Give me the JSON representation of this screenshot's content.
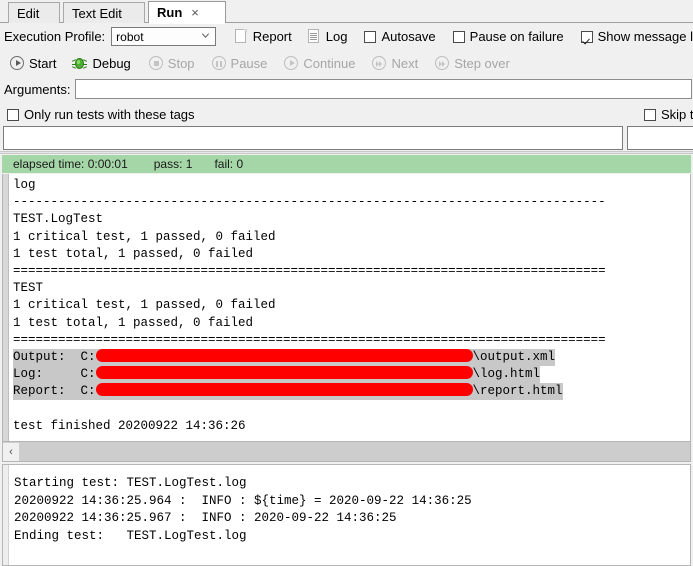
{
  "tabs": [
    {
      "label": "Edit",
      "active": false,
      "closable": false
    },
    {
      "label": "Text Edit",
      "active": false,
      "closable": false
    },
    {
      "label": "Run",
      "active": true,
      "closable": true,
      "close_glyph": "×"
    }
  ],
  "toolbar": {
    "execution_profile_label": "Execution Profile:",
    "execution_profile_value": "robot",
    "execution_profile_options": [
      "robot"
    ],
    "report_label": "Report",
    "log_label": "Log",
    "autosave_label": "Autosave",
    "autosave_checked": false,
    "pause_on_failure_label": "Pause on failure",
    "pause_on_failure_checked": false,
    "show_message_label": "Show message l",
    "show_message_checked": true,
    "start_label": "Start",
    "debug_label": "Debug",
    "stop_label": "Stop",
    "pause_label": "Pause",
    "continue_label": "Continue",
    "next_label": "Next",
    "step_over_label": "Step over",
    "arguments_label": "Arguments:",
    "arguments_value": "",
    "only_run_tags_label": "Only run tests with these tags",
    "only_run_tags_checked": false,
    "only_run_tags_value": "",
    "skip_tests_label": "Skip test",
    "skip_tests_checked": false,
    "skip_tests_value": ""
  },
  "status": {
    "elapsed_label": "elapsed time: 0:00:01",
    "pass_label": "pass: 1",
    "fail_label": "fail: 0",
    "color": "#a5d6a7"
  },
  "log": {
    "lines": [
      "log",
      "-------------------------------------------------------------------------------",
      "TEST.LogTest",
      "1 critical test, 1 passed, 0 failed",
      "1 test total, 1 passed, 0 failed",
      "===============================================================================",
      "TEST",
      "1 critical test, 1 passed, 0 failed",
      "1 test total, 1 passed, 0 failed",
      "==============================================================================="
    ],
    "paths": [
      {
        "label": "Output:  ",
        "prefix": "C:",
        "redacted_width": 377,
        "suffix": "\\output.xml"
      },
      {
        "label": "Log:     ",
        "prefix": "C:",
        "redacted_width": 377,
        "suffix": "\\log.html"
      },
      {
        "label": "Report:  ",
        "prefix": "C:",
        "redacted_width": 377,
        "suffix": "\\report.html"
      }
    ],
    "redaction_color": "#fe0000",
    "highlight_color": "#c8c8c8",
    "finished_line": "test finished 20200922 14:36:26"
  },
  "scrollbar": {
    "left_arrow_glyph": "‹"
  },
  "console": {
    "lines": [
      "Starting test: TEST.LogTest.log",
      "20200922 14:36:25.964 :  INFO : ${time} = 2020-09-22 14:36:25",
      "20200922 14:36:25.967 :  INFO : 2020-09-22 14:36:25",
      "Ending test:   TEST.LogTest.log"
    ]
  }
}
